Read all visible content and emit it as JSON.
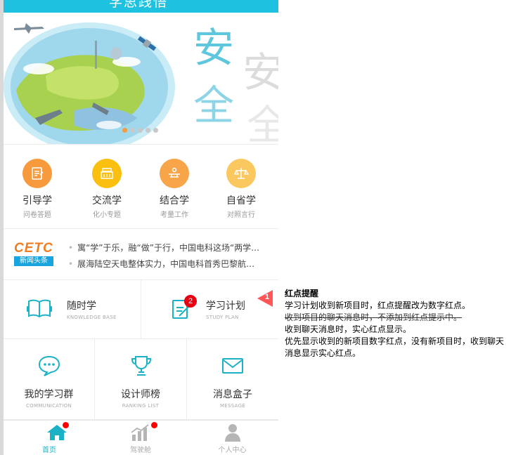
{
  "header": {
    "title": "学思践悟"
  },
  "banner": {
    "chars_left": [
      "安",
      "全"
    ],
    "chars_right": [
      "安",
      "全"
    ],
    "slide_count": 5,
    "active_slide": 1
  },
  "quick_items": [
    {
      "title": "引导学",
      "sub": "问卷答题",
      "color": "#f79a3e"
    },
    {
      "title": "交流学",
      "sub": "化小专题",
      "color": "#fbbf10"
    },
    {
      "title": "结合学",
      "sub": "考量工作",
      "color": "#f8a54a"
    },
    {
      "title": "自省学",
      "sub": "对照言行",
      "color": "#fbc860"
    }
  ],
  "news": {
    "logo": "CETC",
    "badge": "新闻头条",
    "items": [
      "寓“学”于乐，融“做”于行，中国电科这场“两学…",
      "展海陆空天电整体实力，中国电科首秀巴黎航…"
    ]
  },
  "features_top": [
    {
      "title": "随时学",
      "sub": "KNOWLEDGE BASE"
    },
    {
      "title": "学习计划",
      "sub": "STUDY PLAN",
      "badge": "2"
    }
  ],
  "features_bottom": [
    {
      "title": "我的学习群",
      "sub": "COMMUNICATION"
    },
    {
      "title": "设计师榜",
      "sub": "RANKING LIST"
    },
    {
      "title": "消息盒子",
      "sub": "MESSAGE"
    }
  ],
  "tabs": [
    {
      "label": "首页",
      "active": true
    },
    {
      "label": "驾驶舱",
      "active": false
    },
    {
      "label": "个人中心",
      "active": false
    }
  ],
  "annotation": {
    "number": "1",
    "title": "红点提醒",
    "line1": "学习计划收到新项目时，红点提醒改为数字红点。",
    "line2": "收到项目的聊天消息时，不添加到红点提示中。",
    "line3": "收到聊天消息时，实心红点显示。",
    "line4": "优先显示收到的新项目数字红点，没有新项目时，收到聊天消息显示实心红点。"
  },
  "colors": {
    "accent": "#1ec2e0",
    "teal": "#1bb2c6",
    "red": "#e60012"
  }
}
